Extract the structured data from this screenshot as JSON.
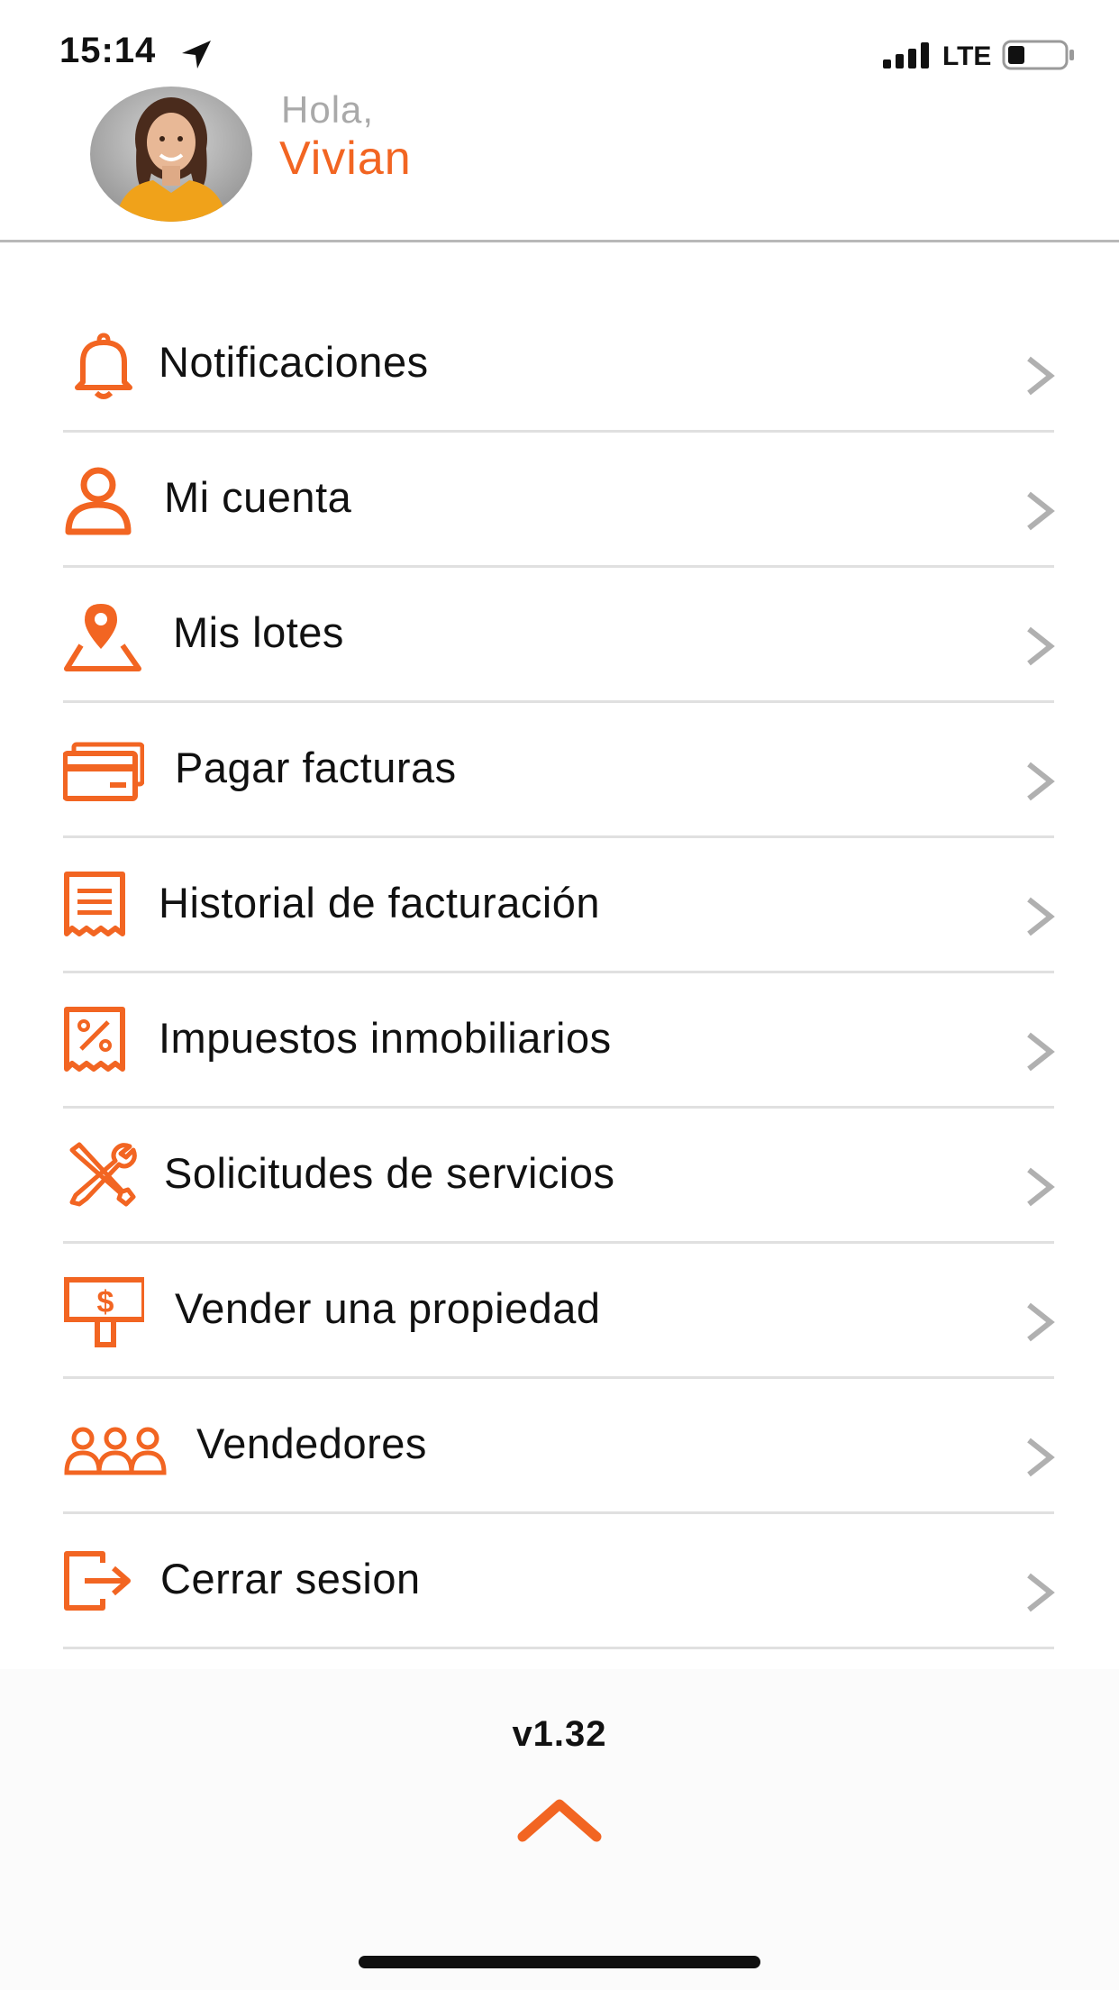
{
  "status_bar": {
    "time": "15:14",
    "network": "LTE",
    "icons": [
      "location-arrow-icon",
      "signal-icon",
      "battery-icon"
    ]
  },
  "header": {
    "greeting": "Hola,",
    "username": "Vivian"
  },
  "menu": {
    "items": [
      {
        "label": "Notificaciones",
        "icon": "bell-icon"
      },
      {
        "label": "Mi cuenta",
        "icon": "user-icon"
      },
      {
        "label": "Mis lotes",
        "icon": "map-pin-icon"
      },
      {
        "label": "Pagar facturas",
        "icon": "credit-card-icon"
      },
      {
        "label": "Historial de facturación",
        "icon": "receipt-icon"
      },
      {
        "label": "Impuestos inmobiliarios",
        "icon": "tax-receipt-icon"
      },
      {
        "label": "Solicitudes de servicios",
        "icon": "tools-icon"
      },
      {
        "label": "Vender una propiedad",
        "icon": "sale-sign-icon"
      },
      {
        "label": "Vendedores",
        "icon": "group-icon"
      },
      {
        "label": "Cerrar sesion",
        "icon": "logout-icon"
      }
    ]
  },
  "footer": {
    "version": "v1.32"
  },
  "colors": {
    "accent": "#f26522",
    "greeting_gray": "#a9a9a9",
    "chevron_gray": "#b0b0b0",
    "divider": "#e0e0e0"
  }
}
